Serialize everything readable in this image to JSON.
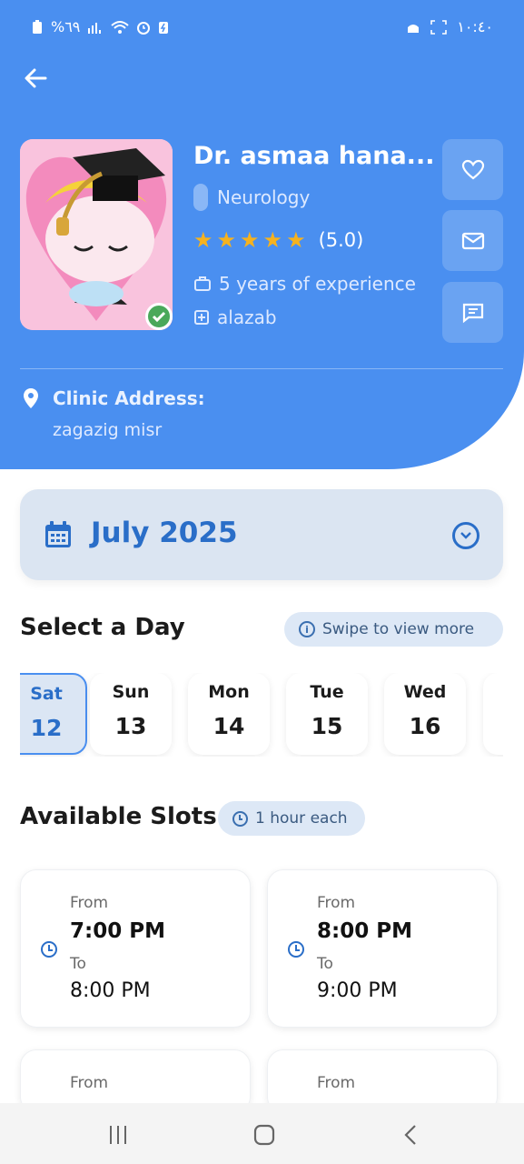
{
  "statusbar": {
    "left": "%٦٩",
    "time": "١٠:٤٠"
  },
  "doctor": {
    "name": "Dr. asmaa hana...",
    "specialty": "Neurology",
    "rating": 5.0,
    "rating_text": "(5.0)",
    "experience": "5 years of experience",
    "location": "alazab"
  },
  "clinic": {
    "label": "Clinic Address:",
    "value": "zagazig misr"
  },
  "month": {
    "label": "July 2025"
  },
  "select_day": {
    "title": "Select a Day",
    "hint": "Swipe to view more",
    "days": [
      {
        "name": "Sat",
        "date": "12",
        "selected": true
      },
      {
        "name": "Sun",
        "date": "13",
        "selected": false
      },
      {
        "name": "Mon",
        "date": "14",
        "selected": false
      },
      {
        "name": "Tue",
        "date": "15",
        "selected": false
      },
      {
        "name": "Wed",
        "date": "16",
        "selected": false
      }
    ]
  },
  "slots": {
    "title": "Available Slots",
    "duration": "1 hour each",
    "from_label": "From",
    "to_label": "To",
    "items": [
      {
        "from": "7:00 PM",
        "to": "8:00 PM"
      },
      {
        "from": "8:00 PM",
        "to": "9:00 PM"
      }
    ]
  },
  "colors": {
    "primary": "#4a8ff0",
    "accent_text": "#2a6ec8",
    "star": "#f6b21e"
  },
  "icons": {
    "back": "arrow-left-icon",
    "favorite": "heart-icon",
    "email": "mail-icon",
    "chat": "chat-icon",
    "calendar": "calendar-icon",
    "location": "pin-icon"
  }
}
